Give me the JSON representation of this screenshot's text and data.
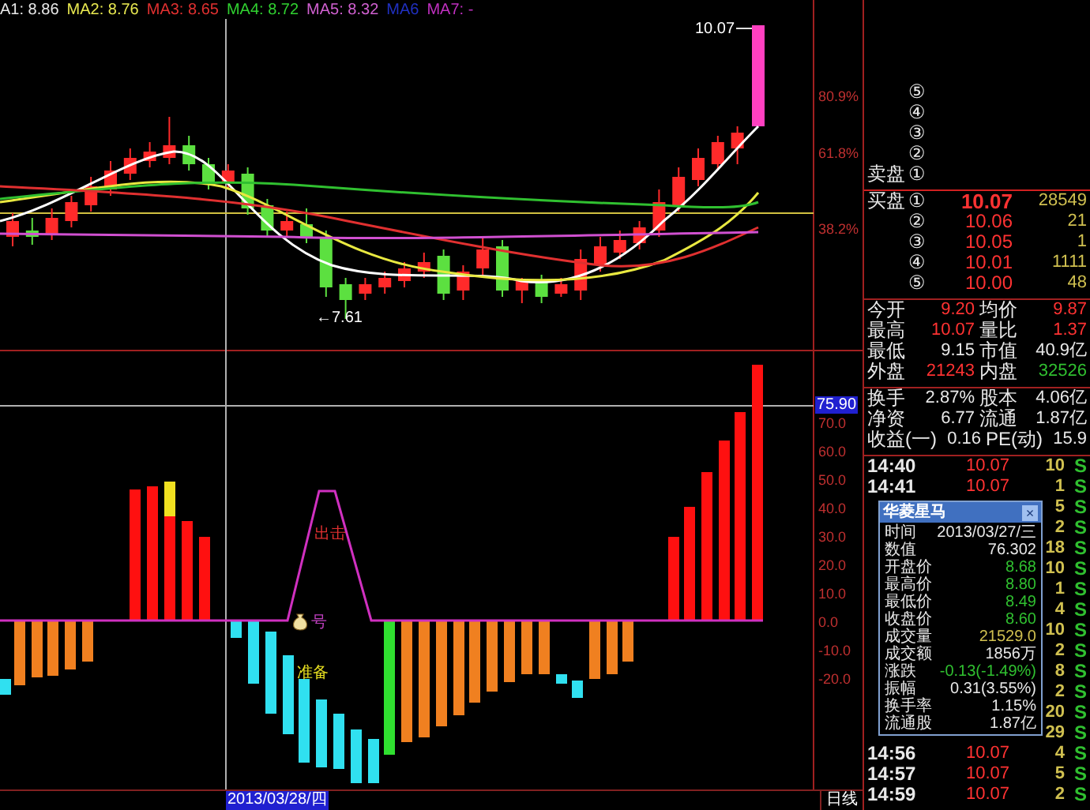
{
  "legend": [
    {
      "label": "A1: 8.86",
      "color": "#e8e8e8"
    },
    {
      "label": "MA2: 8.76",
      "color": "#e8e850"
    },
    {
      "label": "MA3: 8.65",
      "color": "#e03030"
    },
    {
      "label": "MA4: 8.72",
      "color": "#30d030"
    },
    {
      "label": "MA5: 8.32",
      "color": "#d060d0"
    },
    {
      "label": "MA6",
      "color": "#2030c0"
    },
    {
      "label": "MA7: -",
      "color": "#c030c0"
    }
  ],
  "price_chart": {
    "high_marker": "10.07",
    "low_marker": "←7.61",
    "axis_labels": [
      "80.9%",
      "61.8%",
      "38.2%"
    ]
  },
  "indicator_chart": {
    "cursor_value": "75.90",
    "axis_labels": [
      "70.0",
      "60.0",
      "50.0",
      "40.0",
      "30.0",
      "20.0",
      "10.0",
      "0.0",
      "-10.0",
      "-20.0"
    ],
    "annotations": [
      {
        "kind": "text",
        "text": "出击",
        "color": "#e03030"
      },
      {
        "kind": "bag",
        "text": "号",
        "color": "#c040c0"
      },
      {
        "kind": "text",
        "text": "准备",
        "color": "#e8e020"
      }
    ]
  },
  "date_bar": {
    "cursor_date": "2013/03/28/四",
    "period": "日线"
  },
  "order_book": {
    "sell": [
      {
        "index": "⑤"
      },
      {
        "index": "④"
      },
      {
        "index": "③"
      },
      {
        "index": "②"
      },
      {
        "label": "卖盘",
        "index": "①"
      }
    ],
    "buy": [
      {
        "label": "买盘",
        "index": "①",
        "price": "10.07",
        "volume": "28549"
      },
      {
        "index": "②",
        "price": "10.06",
        "volume": "21"
      },
      {
        "index": "③",
        "price": "10.05",
        "volume": "1"
      },
      {
        "index": "④",
        "price": "10.01",
        "volume": "1111"
      },
      {
        "index": "⑤",
        "price": "10.00",
        "volume": "48"
      }
    ]
  },
  "stats": [
    [
      {
        "label": "今开",
        "value": "9.20",
        "color": "#ff3232"
      },
      {
        "label": "均价",
        "value": "9.87",
        "color": "#ff3232"
      }
    ],
    [
      {
        "label": "最高",
        "value": "10.07",
        "color": "#ff3232"
      },
      {
        "label": "量比",
        "value": "1.37",
        "color": "#ff3232"
      }
    ],
    [
      {
        "label": "最低",
        "value": "9.15",
        "color": "#e8e8e8"
      },
      {
        "label": "市值",
        "value": "40.9亿",
        "color": "#e8e8e8"
      }
    ],
    [
      {
        "label": "外盘",
        "value": "21243",
        "color": "#ff3232"
      },
      {
        "label": "内盘",
        "value": "32526",
        "color": "#30c030"
      }
    ],
    [
      {
        "label": "换手",
        "value": "2.87%",
        "color": "#e8e8e8"
      },
      {
        "label": "股本",
        "value": "4.06亿",
        "color": "#e8e8e8"
      }
    ],
    [
      {
        "label": "净资",
        "value": "6.77",
        "color": "#e8e8e8"
      },
      {
        "label": "流通",
        "value": "1.87亿",
        "color": "#e8e8e8"
      }
    ],
    [
      {
        "label": "收益(一)",
        "value": "0.16",
        "color": "#e8e8e8"
      },
      {
        "label": "PE(动)",
        "value": "15.9",
        "color": "#e8e8e8"
      }
    ]
  ],
  "ticks": [
    {
      "time": "14:40",
      "price": "10.07",
      "volume": "10",
      "side": "S"
    },
    {
      "time": "14:41",
      "price": "10.07",
      "volume": "1",
      "side": "S"
    },
    {
      "volume": "5",
      "side": "S"
    },
    {
      "volume": "2",
      "side": "S"
    },
    {
      "volume": "18",
      "side": "S"
    },
    {
      "volume": "10",
      "side": "S"
    },
    {
      "volume": "1",
      "side": "S"
    },
    {
      "volume": "4",
      "side": "S"
    },
    {
      "volume": "10",
      "side": "S"
    },
    {
      "volume": "2",
      "side": "S"
    },
    {
      "volume": "8",
      "side": "S"
    },
    {
      "volume": "2",
      "side": "S"
    },
    {
      "volume": "20",
      "side": "S"
    },
    {
      "volume": "29",
      "side": "S"
    },
    {
      "time": "14:56",
      "price": "10.07",
      "volume": "4",
      "side": "S"
    },
    {
      "time": "14:57",
      "price": "10.07",
      "volume": "5",
      "side": "S"
    },
    {
      "time": "14:59",
      "price": "10.07",
      "volume": "2",
      "side": "S"
    }
  ],
  "popup": {
    "title": "华菱星马",
    "close": "×",
    "rows": [
      {
        "label": "时间",
        "value": "2013/03/27/三",
        "color": "#e8e8e8"
      },
      {
        "label": "数值",
        "value": "76.302",
        "color": "#e8e8e8"
      },
      {
        "label": "开盘价",
        "value": "8.68",
        "color": "#30c030"
      },
      {
        "label": "最高价",
        "value": "8.80",
        "color": "#30c030"
      },
      {
        "label": "最低价",
        "value": "8.49",
        "color": "#30c030"
      },
      {
        "label": "收盘价",
        "value": "8.60",
        "color": "#30c030"
      },
      {
        "label": "成交量",
        "value": "21529.0",
        "color": "#d0c050"
      },
      {
        "label": "成交额",
        "value": "1856万",
        "color": "#e8e8e8"
      },
      {
        "label": "涨跌",
        "value": "-0.13(-1.49%)",
        "color": "#30c030"
      },
      {
        "label": "振幅",
        "value": "0.31(3.55%)",
        "color": "#e8e8e8"
      },
      {
        "label": "换手率",
        "value": "1.15%",
        "color": "#e8e8e8"
      },
      {
        "label": "流通股",
        "value": "1.87亿",
        "color": "#e8e8e8"
      }
    ]
  }
}
